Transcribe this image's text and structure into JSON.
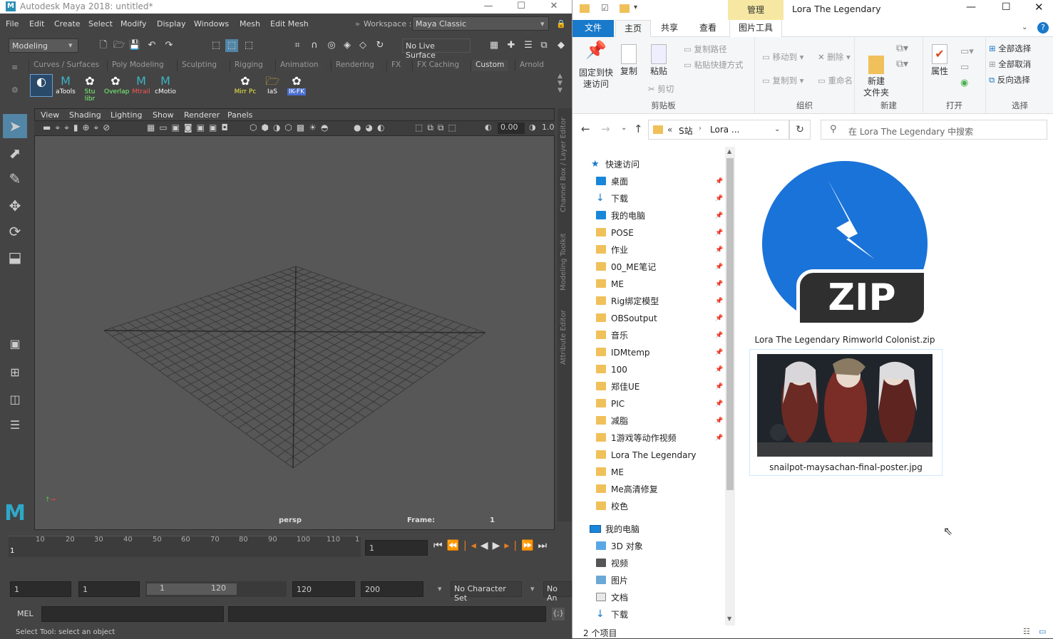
{
  "maya": {
    "title": "Autodesk Maya 2018: untitled*",
    "menu": [
      "File",
      "Edit",
      "Create",
      "Select",
      "Modify",
      "Display",
      "Windows",
      "Mesh",
      "Edit Mesh"
    ],
    "workspace_label": "Workspace :",
    "workspace_value": "Maya Classic",
    "mode_dropdown": "Modeling",
    "live_surface": "No Live Surface",
    "shelf_tabs": [
      "Curves / Surfaces",
      "Poly Modeling",
      "Sculpting",
      "Rigging",
      "Animation",
      "Rendering",
      "FX",
      "FX Caching",
      "Custom",
      "Arnold"
    ],
    "active_shelf_tab": "Custom",
    "shelf_buttons": [
      "aTools",
      "Stu libr",
      "Overlap",
      "Mtrail",
      "cMotio",
      "Mirr Pc",
      "IaS",
      "IK-FK"
    ],
    "viewport_menu": [
      "View",
      "Shading",
      "Lighting",
      "Show",
      "Renderer",
      "Panels"
    ],
    "viewport_value": "0.00",
    "viewport_value2": "1.0",
    "camera_label": "persp",
    "frame_label": "Frame:",
    "frame_value": "1",
    "right_tabs": [
      "Channel Box / Layer Editor",
      "Modeling Toolkit",
      "Attribute Editor"
    ],
    "timeline_ticks": [
      "10",
      "20",
      "30",
      "40",
      "50",
      "60",
      "70",
      "80",
      "90",
      "100",
      "110",
      "1"
    ],
    "timeline_start_marker": "1",
    "current_frame": "1",
    "range": {
      "start": "1",
      "playback_start": "1",
      "slider_start": "1",
      "slider_end": "120",
      "playback_end": "120",
      "end": "200",
      "character_set": "No Character Set",
      "anim_layer": "No An"
    },
    "cmd_label": "MEL",
    "help_line": "Select Tool: select an object"
  },
  "explorer": {
    "window_title": "Lora The Legendary",
    "manage_tab": "管理",
    "picture_tools_tab": "图片工具",
    "tabs": [
      "文件",
      "主页",
      "共享",
      "查看"
    ],
    "active_tab": "主页",
    "ribbon": {
      "clipboard": {
        "label": "剪贴板",
        "pin": "固定到快速访问",
        "copy": "复制",
        "paste": "粘贴",
        "copy_path": "复制路径",
        "paste_shortcut": "粘贴快捷方式",
        "cut": "剪切"
      },
      "organize": {
        "label": "组织",
        "move_to": "移动到",
        "copy_to": "复制到",
        "delete": "删除",
        "rename": "重命名"
      },
      "new": {
        "label": "新建",
        "new_folder": "新建\n文件夹"
      },
      "open": {
        "label": "打开",
        "properties": "属性"
      },
      "select": {
        "label": "选择",
        "select_all": "全部选择",
        "select_none": "全部取消",
        "invert": "反向选择"
      }
    },
    "breadcrumb": [
      "«",
      "S站",
      "Lora ..."
    ],
    "search_placeholder": "在 Lora The Legendary 中搜索",
    "nav_quick_access": "快速访问",
    "nav_items": [
      {
        "label": "桌面",
        "pinned": true,
        "icon": "desktop"
      },
      {
        "label": "下载",
        "pinned": true,
        "icon": "download"
      },
      {
        "label": "我的电脑",
        "pinned": true,
        "icon": "pc"
      },
      {
        "label": "POSE",
        "pinned": true,
        "icon": "folder"
      },
      {
        "label": "作业",
        "pinned": true,
        "icon": "folder"
      },
      {
        "label": "00_ME笔记",
        "pinned": true,
        "icon": "folder"
      },
      {
        "label": "ME",
        "pinned": true,
        "icon": "folder"
      },
      {
        "label": "Rig绑定模型",
        "pinned": true,
        "icon": "folder"
      },
      {
        "label": "OBSoutput",
        "pinned": true,
        "icon": "folder"
      },
      {
        "label": "音乐",
        "pinned": true,
        "icon": "folder"
      },
      {
        "label": "IDMtemp",
        "pinned": true,
        "icon": "folder"
      },
      {
        "label": "100",
        "pinned": true,
        "icon": "folder"
      },
      {
        "label": "郑佳UE",
        "pinned": true,
        "icon": "folder"
      },
      {
        "label": "PIC",
        "pinned": true,
        "icon": "folder"
      },
      {
        "label": "减脂",
        "pinned": true,
        "icon": "folder"
      },
      {
        "label": "1游戏等动作视频",
        "pinned": true,
        "icon": "folder"
      },
      {
        "label": "Lora The Legendary",
        "pinned": false,
        "icon": "folder"
      },
      {
        "label": "ME",
        "pinned": false,
        "icon": "folder"
      },
      {
        "label": "Me高清修复",
        "pinned": false,
        "icon": "folder"
      },
      {
        "label": "校色",
        "pinned": false,
        "icon": "folder"
      }
    ],
    "nav_this_pc": "我的电脑",
    "nav_pc_items": [
      {
        "label": "3D 对象",
        "icon": "3d"
      },
      {
        "label": "视频",
        "icon": "video"
      },
      {
        "label": "图片",
        "icon": "picture"
      },
      {
        "label": "文档",
        "icon": "doc"
      },
      {
        "label": "下载",
        "icon": "download"
      }
    ],
    "files": [
      {
        "name": "Lora The Legendary Rimworld Colonist.zip",
        "type": "zip",
        "badge": "ZIP"
      },
      {
        "name": "snailpot-maysachan-final-poster.jpg",
        "type": "image"
      }
    ],
    "status": "2 个项目",
    "colors": {
      "file_tab": "#1979ca",
      "manage_tab": "#f6e8a3",
      "zip_blue": "#1a73d9",
      "folder": "#f0c05a"
    }
  }
}
